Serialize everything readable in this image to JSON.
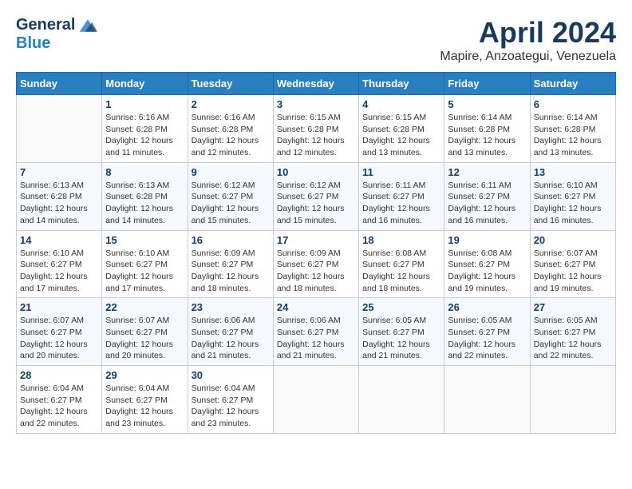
{
  "logo": {
    "general": "General",
    "blue": "Blue"
  },
  "header": {
    "title": "April 2024",
    "subtitle": "Mapire, Anzoategui, Venezuela"
  },
  "days_of_week": [
    "Sunday",
    "Monday",
    "Tuesday",
    "Wednesday",
    "Thursday",
    "Friday",
    "Saturday"
  ],
  "weeks": [
    [
      {
        "num": "",
        "info": ""
      },
      {
        "num": "1",
        "info": "Sunrise: 6:16 AM\nSunset: 6:28 PM\nDaylight: 12 hours\nand 11 minutes."
      },
      {
        "num": "2",
        "info": "Sunrise: 6:16 AM\nSunset: 6:28 PM\nDaylight: 12 hours\nand 12 minutes."
      },
      {
        "num": "3",
        "info": "Sunrise: 6:15 AM\nSunset: 6:28 PM\nDaylight: 12 hours\nand 12 minutes."
      },
      {
        "num": "4",
        "info": "Sunrise: 6:15 AM\nSunset: 6:28 PM\nDaylight: 12 hours\nand 13 minutes."
      },
      {
        "num": "5",
        "info": "Sunrise: 6:14 AM\nSunset: 6:28 PM\nDaylight: 12 hours\nand 13 minutes."
      },
      {
        "num": "6",
        "info": "Sunrise: 6:14 AM\nSunset: 6:28 PM\nDaylight: 12 hours\nand 13 minutes."
      }
    ],
    [
      {
        "num": "7",
        "info": "Sunrise: 6:13 AM\nSunset: 6:28 PM\nDaylight: 12 hours\nand 14 minutes."
      },
      {
        "num": "8",
        "info": "Sunrise: 6:13 AM\nSunset: 6:28 PM\nDaylight: 12 hours\nand 14 minutes."
      },
      {
        "num": "9",
        "info": "Sunrise: 6:12 AM\nSunset: 6:27 PM\nDaylight: 12 hours\nand 15 minutes."
      },
      {
        "num": "10",
        "info": "Sunrise: 6:12 AM\nSunset: 6:27 PM\nDaylight: 12 hours\nand 15 minutes."
      },
      {
        "num": "11",
        "info": "Sunrise: 6:11 AM\nSunset: 6:27 PM\nDaylight: 12 hours\nand 16 minutes."
      },
      {
        "num": "12",
        "info": "Sunrise: 6:11 AM\nSunset: 6:27 PM\nDaylight: 12 hours\nand 16 minutes."
      },
      {
        "num": "13",
        "info": "Sunrise: 6:10 AM\nSunset: 6:27 PM\nDaylight: 12 hours\nand 16 minutes."
      }
    ],
    [
      {
        "num": "14",
        "info": "Sunrise: 6:10 AM\nSunset: 6:27 PM\nDaylight: 12 hours\nand 17 minutes."
      },
      {
        "num": "15",
        "info": "Sunrise: 6:10 AM\nSunset: 6:27 PM\nDaylight: 12 hours\nand 17 minutes."
      },
      {
        "num": "16",
        "info": "Sunrise: 6:09 AM\nSunset: 6:27 PM\nDaylight: 12 hours\nand 18 minutes."
      },
      {
        "num": "17",
        "info": "Sunrise: 6:09 AM\nSunset: 6:27 PM\nDaylight: 12 hours\nand 18 minutes."
      },
      {
        "num": "18",
        "info": "Sunrise: 6:08 AM\nSunset: 6:27 PM\nDaylight: 12 hours\nand 18 minutes."
      },
      {
        "num": "19",
        "info": "Sunrise: 6:08 AM\nSunset: 6:27 PM\nDaylight: 12 hours\nand 19 minutes."
      },
      {
        "num": "20",
        "info": "Sunrise: 6:07 AM\nSunset: 6:27 PM\nDaylight: 12 hours\nand 19 minutes."
      }
    ],
    [
      {
        "num": "21",
        "info": "Sunrise: 6:07 AM\nSunset: 6:27 PM\nDaylight: 12 hours\nand 20 minutes."
      },
      {
        "num": "22",
        "info": "Sunrise: 6:07 AM\nSunset: 6:27 PM\nDaylight: 12 hours\nand 20 minutes."
      },
      {
        "num": "23",
        "info": "Sunrise: 6:06 AM\nSunset: 6:27 PM\nDaylight: 12 hours\nand 21 minutes."
      },
      {
        "num": "24",
        "info": "Sunrise: 6:06 AM\nSunset: 6:27 PM\nDaylight: 12 hours\nand 21 minutes."
      },
      {
        "num": "25",
        "info": "Sunrise: 6:05 AM\nSunset: 6:27 PM\nDaylight: 12 hours\nand 21 minutes."
      },
      {
        "num": "26",
        "info": "Sunrise: 6:05 AM\nSunset: 6:27 PM\nDaylight: 12 hours\nand 22 minutes."
      },
      {
        "num": "27",
        "info": "Sunrise: 6:05 AM\nSunset: 6:27 PM\nDaylight: 12 hours\nand 22 minutes."
      }
    ],
    [
      {
        "num": "28",
        "info": "Sunrise: 6:04 AM\nSunset: 6:27 PM\nDaylight: 12 hours\nand 22 minutes."
      },
      {
        "num": "29",
        "info": "Sunrise: 6:04 AM\nSunset: 6:27 PM\nDaylight: 12 hours\nand 23 minutes."
      },
      {
        "num": "30",
        "info": "Sunrise: 6:04 AM\nSunset: 6:27 PM\nDaylight: 12 hours\nand 23 minutes."
      },
      {
        "num": "",
        "info": ""
      },
      {
        "num": "",
        "info": ""
      },
      {
        "num": "",
        "info": ""
      },
      {
        "num": "",
        "info": ""
      }
    ]
  ]
}
